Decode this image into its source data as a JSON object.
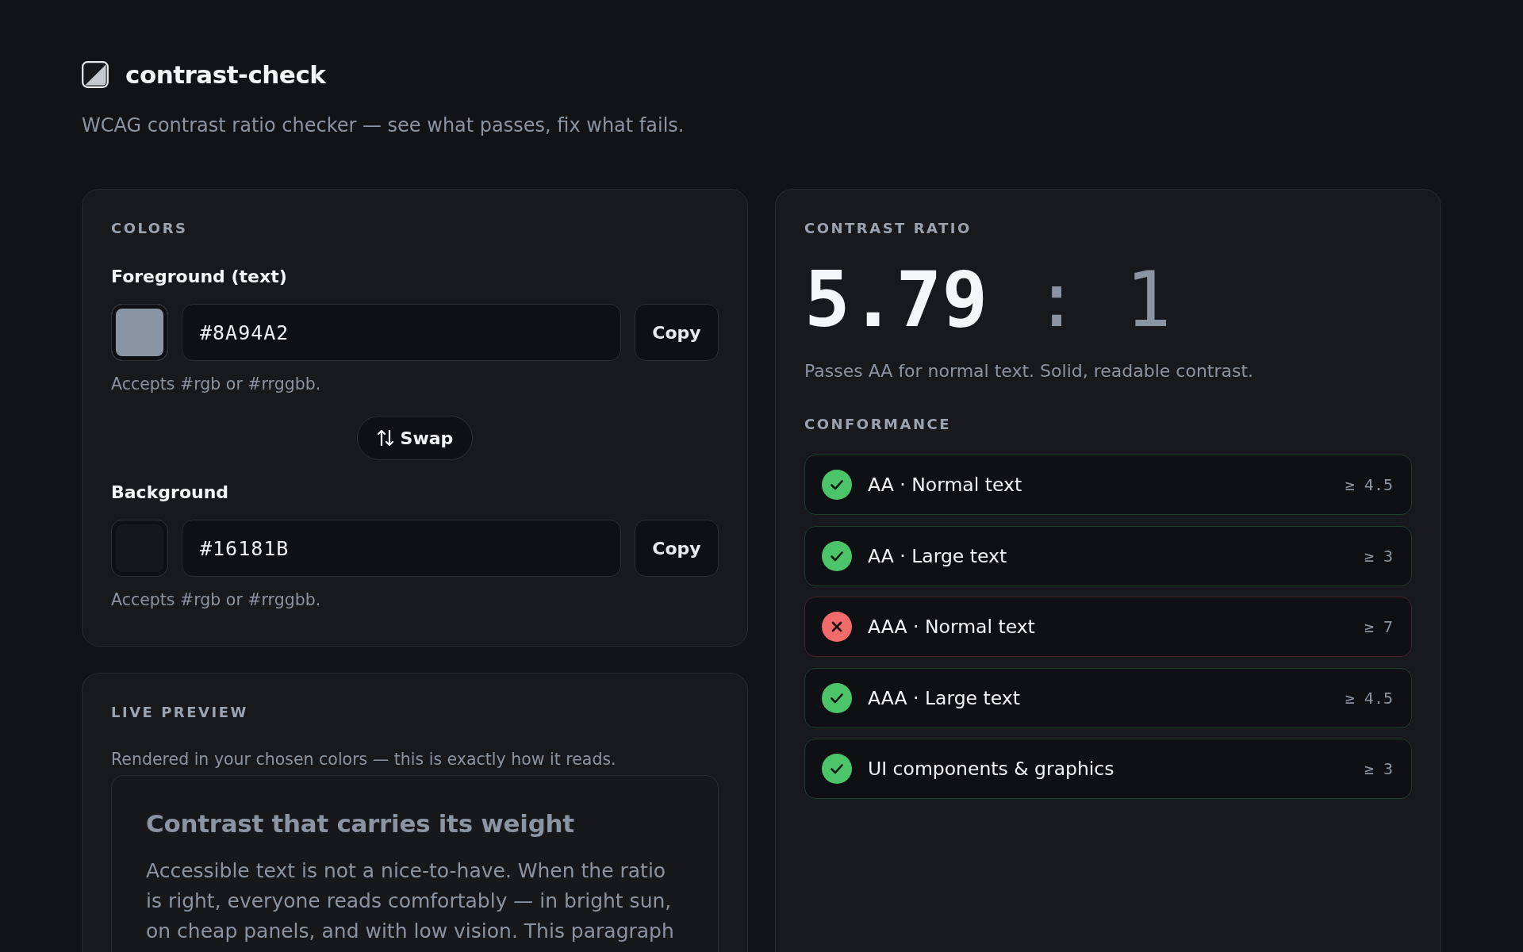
{
  "header": {
    "title": "contrast-check",
    "tagline": "WCAG contrast ratio checker — see what passes, fix what fails."
  },
  "colors": {
    "heading": "COLORS",
    "foreground": {
      "label": "Foreground (text)",
      "color": "#8a94a2",
      "value": "#8A94A2",
      "copy_button": "Copy",
      "hint": "Accepts #rgb or #rrggbb."
    },
    "swap_button": "Swap",
    "background": {
      "label": "Background",
      "color": "#16181b",
      "value": "#16181B",
      "copy_button": "Copy",
      "hint": "Accepts #rgb or #rrggbb."
    }
  },
  "preview": {
    "heading": "LIVE PREVIEW",
    "caption": "Rendered in your chosen colors — this is exactly how it reads.",
    "sample_heading": "Contrast that carries its weight",
    "sample_text": "Accessible text is not a nice-to-have. When the ratio is right, everyone reads comfortably — in bright sun, on cheap panels, and with low vision. This paragraph"
  },
  "result": {
    "heading": "CONTRAST RATIO",
    "ratio": "5.79",
    "ratio_suffix": ": 1",
    "summary": "Passes AA for normal text. Solid, readable contrast.",
    "conformance_heading": "CONFORMANCE",
    "checks": [
      {
        "label": "AA · Normal text",
        "threshold": "≥ 4.5",
        "passed": true
      },
      {
        "label": "AA · Large text",
        "threshold": "≥ 3",
        "passed": true
      },
      {
        "label": "AAA · Normal text",
        "threshold": "≥ 7",
        "passed": false
      },
      {
        "label": "AAA · Large text",
        "threshold": "≥ 4.5",
        "passed": true
      },
      {
        "label": "UI components & graphics",
        "threshold": "≥ 3",
        "passed": true
      }
    ]
  }
}
